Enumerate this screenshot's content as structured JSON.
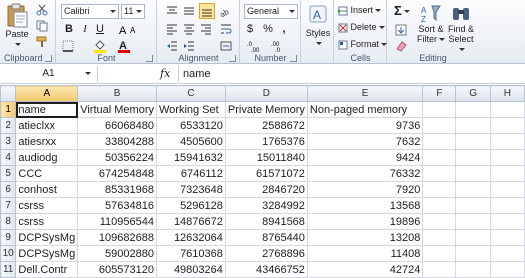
{
  "ribbon": {
    "clipboard": {
      "label": "Clipboard",
      "paste_label": "Paste"
    },
    "font": {
      "label": "Font",
      "font_name": "Calibri",
      "font_size": "11",
      "bold": "B",
      "italic": "I",
      "underline": "U",
      "font_color_glyph": "A"
    },
    "alignment": {
      "label": "Alignment"
    },
    "number": {
      "label": "Number",
      "format": "General",
      "currency": "$",
      "percent": "%",
      "comma": ","
    },
    "styles": {
      "label": "Styles"
    },
    "cells": {
      "label": "Cells",
      "insert": "Insert",
      "delete": "Delete",
      "format": "Format"
    },
    "editing": {
      "label": "Editing",
      "sigma": "Σ",
      "sort_filter_1": "Sort &",
      "sort_filter_2": "Filter",
      "find_1": "Find &",
      "find_2": "Select"
    }
  },
  "formula_bar": {
    "cell_ref": "A1",
    "fx": "fx",
    "content": "name"
  },
  "grid": {
    "columns": [
      "A",
      "B",
      "C",
      "D",
      "E",
      "F",
      "G",
      "H"
    ],
    "rows": [
      {
        "n": "1",
        "a": "name",
        "b": "Virtual Memory",
        "c": "Working Set",
        "d": "Private Memory",
        "e": "Non-paged memory"
      },
      {
        "n": "2",
        "a": "atieclxx",
        "b": "66068480",
        "c": "6533120",
        "d": "2588672",
        "e": "9736"
      },
      {
        "n": "3",
        "a": "atiesrxx",
        "b": "33804288",
        "c": "4505600",
        "d": "1765376",
        "e": "7632"
      },
      {
        "n": "4",
        "a": "audiodg",
        "b": "50356224",
        "c": "15941632",
        "d": "15011840",
        "e": "9424"
      },
      {
        "n": "5",
        "a": "CCC",
        "b": "674254848",
        "c": "6746112",
        "d": "61571072",
        "e": "76332"
      },
      {
        "n": "6",
        "a": "conhost",
        "b": "85331968",
        "c": "7323648",
        "d": "2846720",
        "e": "7920"
      },
      {
        "n": "7",
        "a": "csrss",
        "b": "57634816",
        "c": "5296128",
        "d": "3284992",
        "e": "13568"
      },
      {
        "n": "8",
        "a": "csrss",
        "b": "110956544",
        "c": "14876672",
        "d": "8941568",
        "e": "19896"
      },
      {
        "n": "9",
        "a": "DCPSysMg",
        "b": "109682688",
        "c": "12632064",
        "d": "8765440",
        "e": "13208"
      },
      {
        "n": "10",
        "a": "DCPSysMg",
        "b": "59002880",
        "c": "7610368",
        "d": "2768896",
        "e": "11408"
      },
      {
        "n": "11",
        "a": "Dell.Contr",
        "b": "605573120",
        "c": "49803264",
        "d": "43466752",
        "e": "42724"
      }
    ]
  }
}
